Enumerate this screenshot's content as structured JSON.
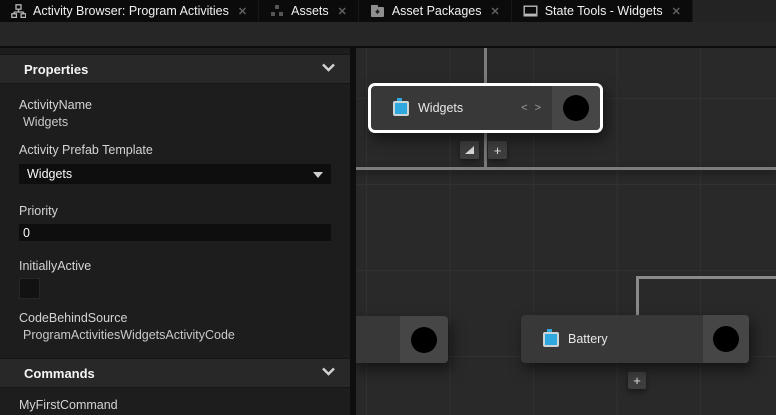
{
  "tabbar": {
    "tabs": [
      {
        "label": "Activity Browser: Program Activities",
        "icon": "org-chart-icon",
        "active": true
      },
      {
        "label": "Assets",
        "icon": "assets-cluster-icon",
        "active": false
      },
      {
        "label": "Asset Packages",
        "icon": "package-icon",
        "active": false
      },
      {
        "label": "State Tools - Widgets",
        "icon": "window-icon",
        "active": false
      }
    ],
    "close_glyph": "✕"
  },
  "properties_panel": {
    "header": "Properties",
    "fields": {
      "activity_name_label": "ActivityName",
      "activity_name_value": "Widgets",
      "prefab_label": "Activity Prefab Template",
      "prefab_value": "Widgets",
      "priority_label": "Priority",
      "priority_value": "0",
      "initially_active_label": "InitiallyActive",
      "initially_active_checked": false,
      "code_behind_label": "CodeBehindSource",
      "code_behind_value": "ProgramActivitiesWidgetsActivityCode"
    },
    "commands_header": "Commands",
    "commands": [
      "MyFirstCommand"
    ]
  },
  "graph": {
    "nodes": [
      {
        "label": "Widgets",
        "selected": true,
        "badge": "< >"
      },
      {
        "label": "Battery",
        "selected": false
      },
      {
        "label": "",
        "selected": false,
        "note": "partially visible node at left edge"
      }
    ],
    "widgets_badge": "< >",
    "add_button_label": "+",
    "collapse_button_glyph": "resize-grip-triangle"
  },
  "icons": {
    "close": "✕",
    "chevron_down": "⌄",
    "dropdown_arrow": "▾",
    "plus": "+",
    "resize_grip": "◢",
    "node_device": "blue-device-icon",
    "port": "black-circle"
  },
  "colors": {
    "accent_blue": "#2fa8e0",
    "graph_bg": "#292929",
    "grid_line": "#313131",
    "panel_bg": "#1d1d1d",
    "section_header_bg": "#282828",
    "node_bg": "#383838",
    "node_port_bg": "#464646",
    "selection_border": "#ffffff",
    "connector": "#7d7d7d",
    "tab_bg": "#0b0b0b",
    "input_bg": "#0e0e0e"
  }
}
